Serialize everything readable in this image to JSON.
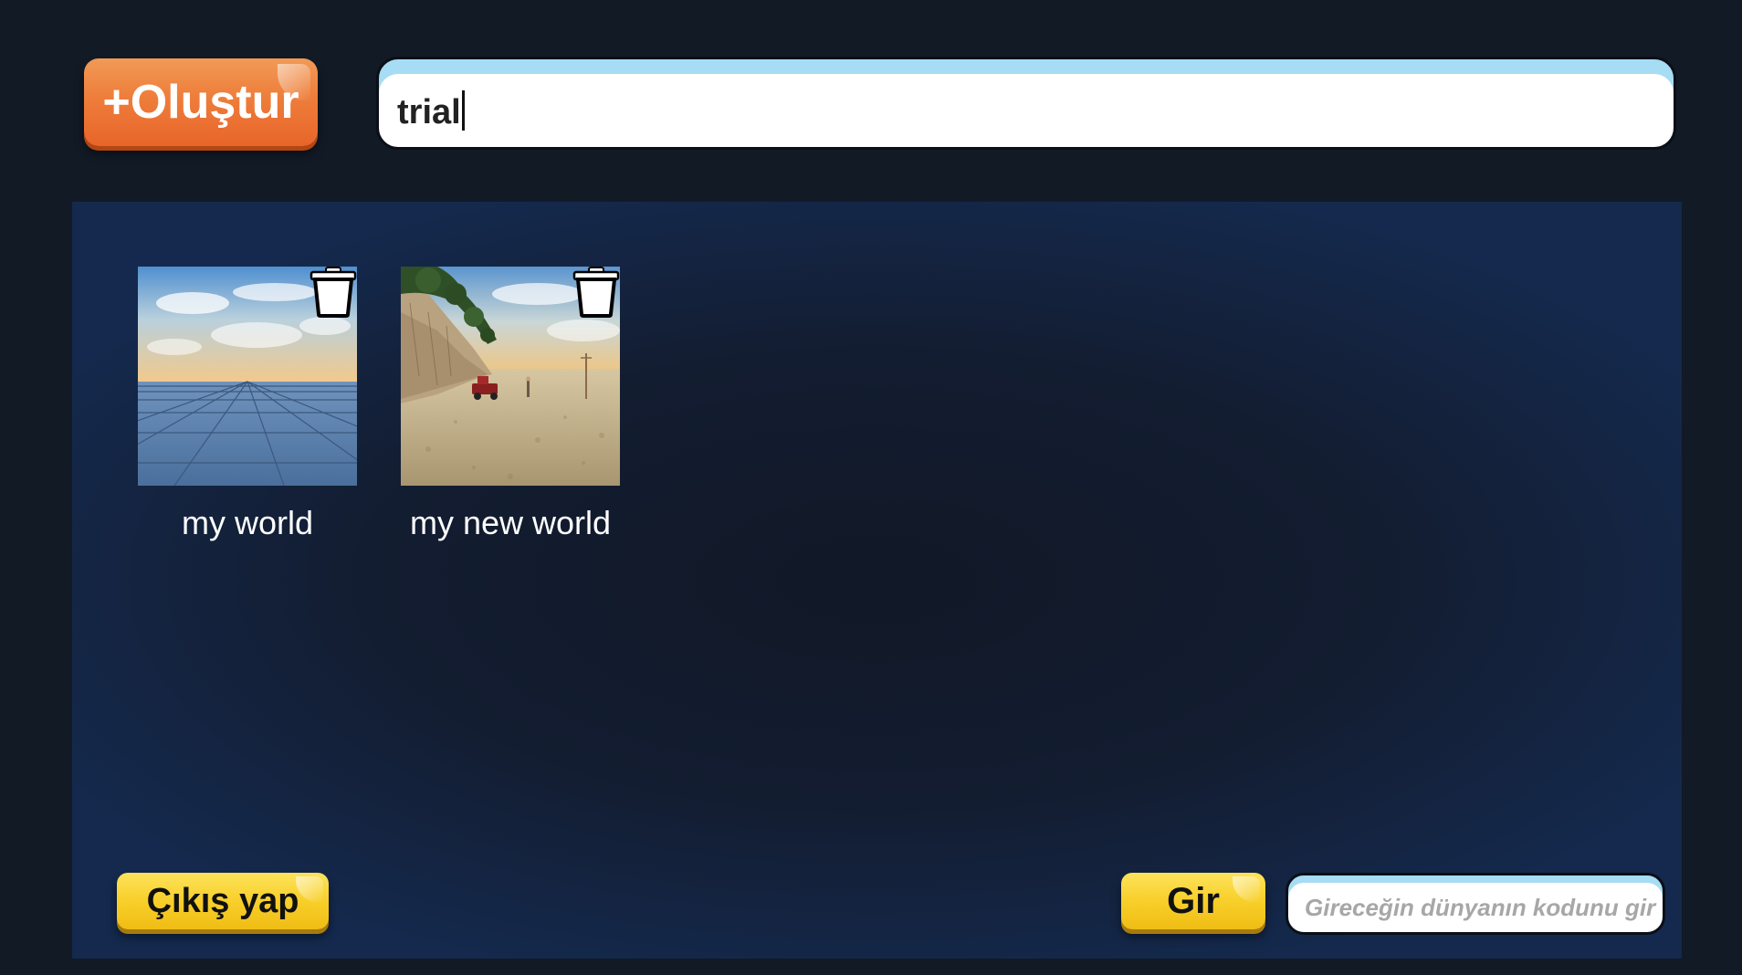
{
  "header": {
    "create_label": "+Oluştur",
    "name_input_value": "trial"
  },
  "worlds": [
    {
      "name": "my world",
      "thumbnail": "empty-grid-world"
    },
    {
      "name": "my new world",
      "thumbnail": "desert-cliff-world-with-truck"
    }
  ],
  "footer": {
    "logout_label": "Çıkış yap",
    "enter_label": "Gir",
    "code_placeholder": "Gireceğin dünyanın kodunu gir"
  },
  "colors": {
    "create_button": "#ee7d3a",
    "yellow_button": "#f8cf2a",
    "panel": "#14294d",
    "background": "#121a26"
  }
}
